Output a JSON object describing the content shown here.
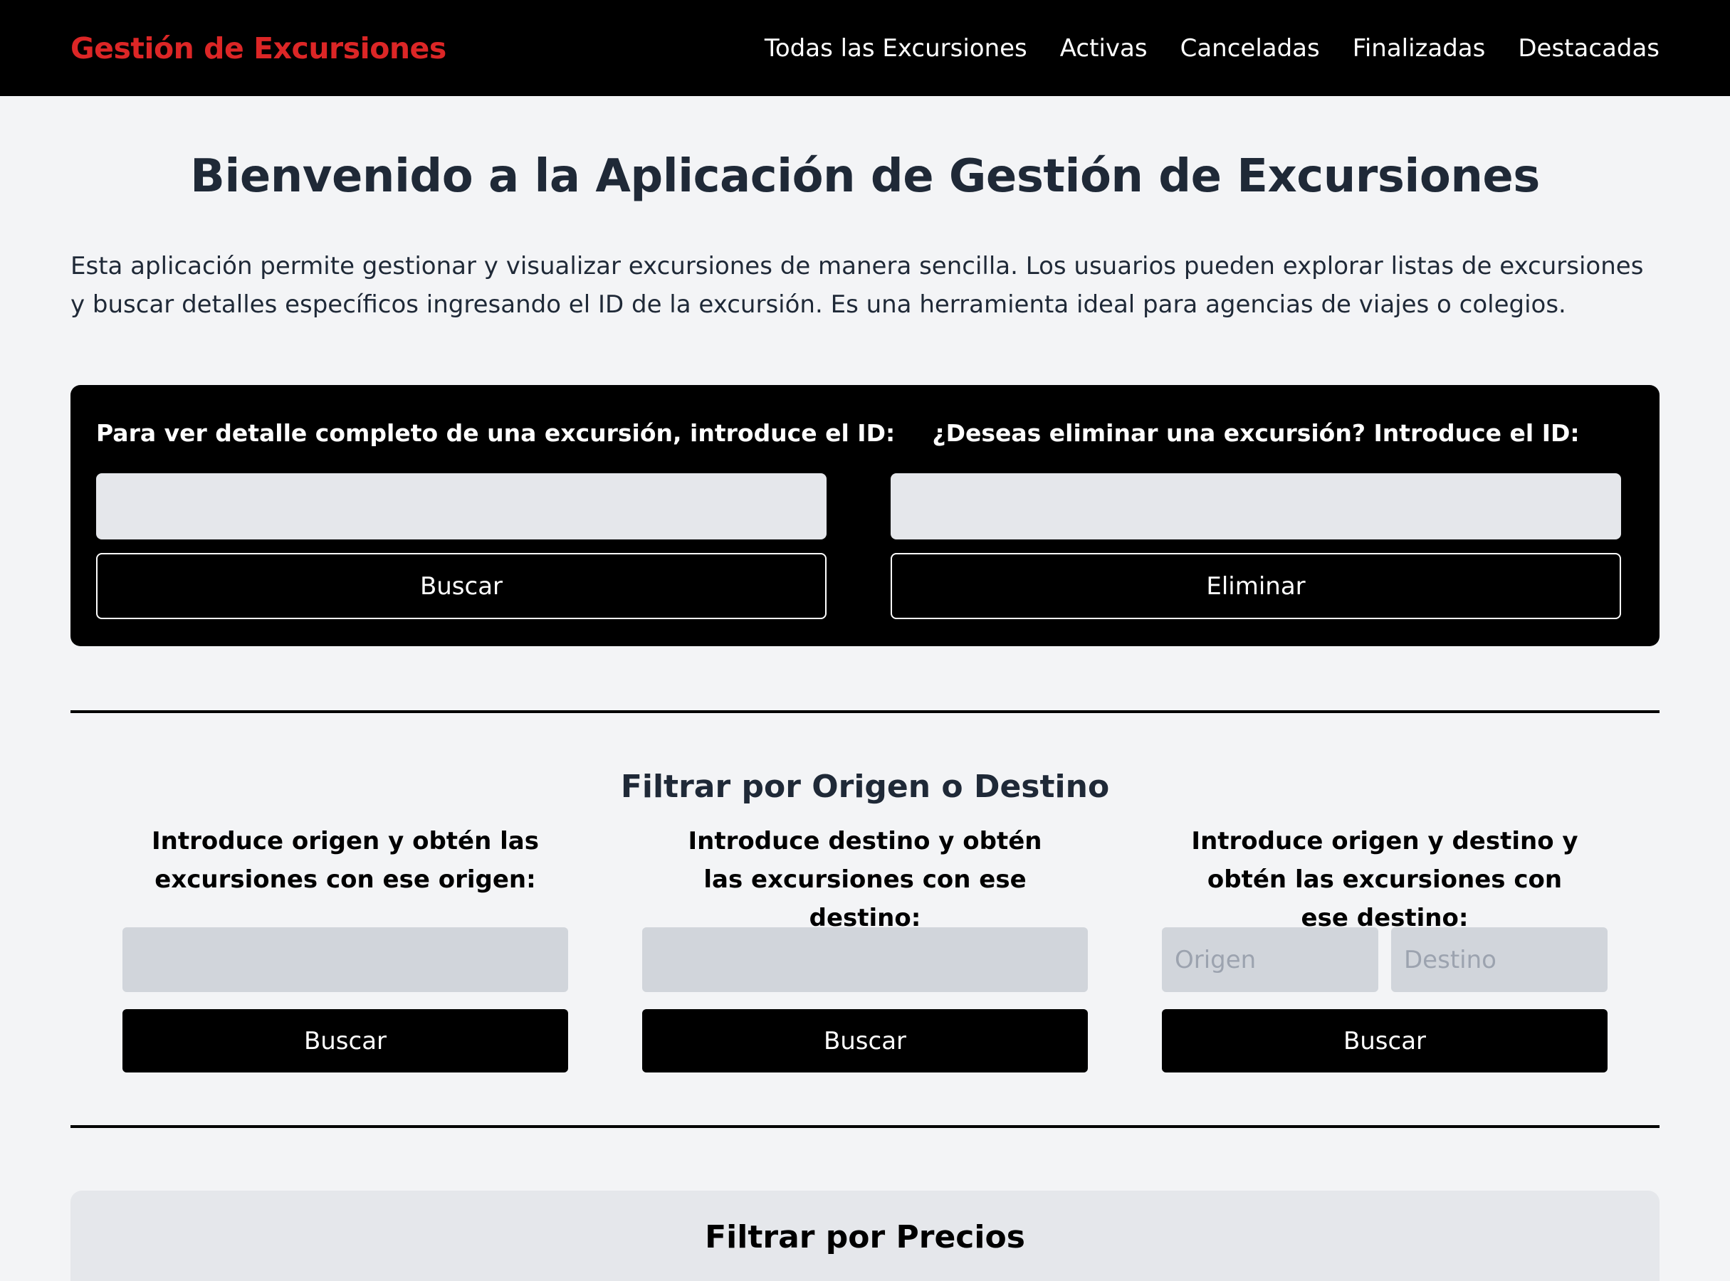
{
  "navbar": {
    "brand": "Gestión de Excursiones",
    "links": [
      "Todas las Excursiones",
      "Activas",
      "Canceladas",
      "Finalizadas",
      "Destacadas"
    ]
  },
  "main": {
    "title": "Bienvenido a la Aplicación de Gestión de Excursiones",
    "intro": "Esta aplicación permite gestionar y visualizar excursiones de manera sencilla. Los usuarios pueden explorar listas de excursiones y buscar detalles específicos ingresando el ID de la excursión. Es una herramienta ideal para agencias de viajes o colegios."
  },
  "id_panel": {
    "detail_label": "Para ver detalle completo de una excursión, introduce el ID:",
    "detail_value": "",
    "detail_button": "Buscar",
    "delete_label": "¿Deseas eliminar una excursión? Introduce el ID:",
    "delete_value": "",
    "delete_button": "Eliminar"
  },
  "filter_origin_dest": {
    "title": "Filtrar por Origen o Destino",
    "origin_label": "Introduce origen y obtén las excursiones con ese origen:",
    "origin_value": "",
    "origin_button": "Buscar",
    "dest_label": "Introduce destino y obtén las excursiones con ese destino:",
    "dest_value": "",
    "dest_button": "Buscar",
    "both_label": "Introduce origen y destino y obtén las excursiones con ese destino:",
    "both_origin_placeholder": "Origen",
    "both_dest_placeholder": "Destino",
    "both_button": "Buscar"
  },
  "filter_price": {
    "title": "Filtrar por Precios"
  },
  "colors": {
    "brand": "#dc2626",
    "navbar_bg": "#000000",
    "page_bg": "#f3f4f6",
    "text": "#1f2937"
  }
}
